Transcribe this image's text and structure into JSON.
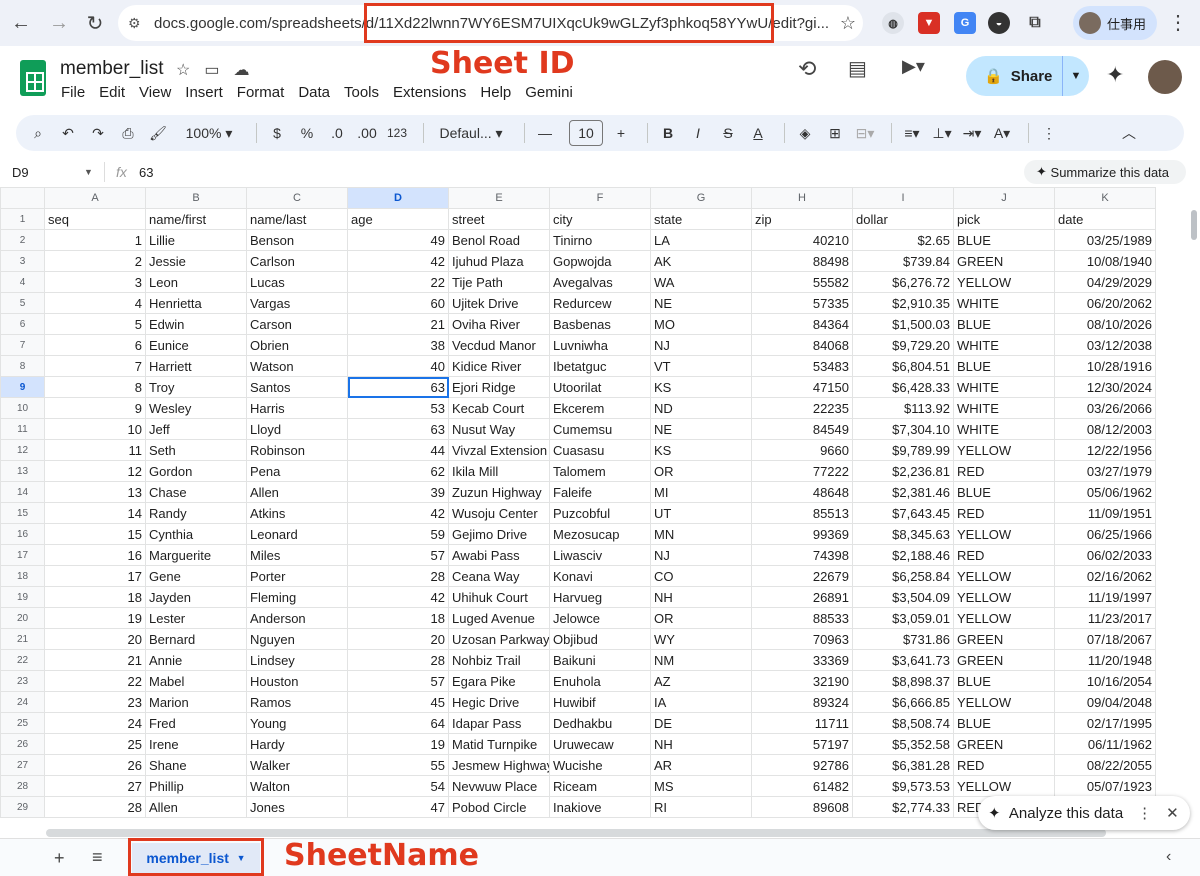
{
  "browser": {
    "url": "docs.google.com/spreadsheets/d/11Xd22lwnn7WY6ESM7UIXqcUk9wGLZyf3phkoq58YYwU/edit?gi...",
    "profile_label": "仕事用"
  },
  "annotations": {
    "sheet_id_label": "Sheet ID",
    "sheet_name_label": "SheetName"
  },
  "doc": {
    "title": "member_list",
    "menus": [
      "File",
      "Edit",
      "View",
      "Insert",
      "Format",
      "Data",
      "Tools",
      "Extensions",
      "Help",
      "Gemini"
    ],
    "share_label": "Share"
  },
  "toolbar": {
    "zoom": "100%",
    "currency": "$",
    "percent": "%",
    "dec_decrease": ".0",
    "dec_increase": ".00",
    "format_123": "123",
    "font": "Defaul...",
    "font_size": "10"
  },
  "formula_bar": {
    "cell_ref": "D9",
    "value": "63",
    "summarize_label": "Summarize this data"
  },
  "grid": {
    "column_letters": [
      "A",
      "B",
      "C",
      "D",
      "E",
      "F",
      "G",
      "H",
      "I",
      "J",
      "K"
    ],
    "headers": [
      "seq",
      "name/first",
      "name/last",
      "age",
      "street",
      "city",
      "state",
      "zip",
      "dollar",
      "pick",
      "date"
    ],
    "rows": [
      [
        "1",
        "Lillie",
        "Benson",
        "49",
        "Benol Road",
        "Tinirno",
        "LA",
        "40210",
        "$2.65",
        "BLUE",
        "03/25/1989"
      ],
      [
        "2",
        "Jessie",
        "Carlson",
        "42",
        "Ijuhud Plaza",
        "Gopwojda",
        "AK",
        "88498",
        "$739.84",
        "GREEN",
        "10/08/1940"
      ],
      [
        "3",
        "Leon",
        "Lucas",
        "22",
        "Tije Path",
        "Avegalvas",
        "WA",
        "55582",
        "$6,276.72",
        "YELLOW",
        "04/29/2029"
      ],
      [
        "4",
        "Henrietta",
        "Vargas",
        "60",
        "Ujitek Drive",
        "Redurcew",
        "NE",
        "57335",
        "$2,910.35",
        "WHITE",
        "06/20/2062"
      ],
      [
        "5",
        "Edwin",
        "Carson",
        "21",
        "Oviha River",
        "Basbenas",
        "MO",
        "84364",
        "$1,500.03",
        "BLUE",
        "08/10/2026"
      ],
      [
        "6",
        "Eunice",
        "Obrien",
        "38",
        "Vecdud Manor",
        "Luvniwha",
        "NJ",
        "84068",
        "$9,729.20",
        "WHITE",
        "03/12/2038"
      ],
      [
        "7",
        "Harriett",
        "Watson",
        "40",
        "Kidice River",
        "Ibetatguc",
        "VT",
        "53483",
        "$6,804.51",
        "BLUE",
        "10/28/1916"
      ],
      [
        "8",
        "Troy",
        "Santos",
        "63",
        "Ejori Ridge",
        "Utoorilat",
        "KS",
        "47150",
        "$6,428.33",
        "WHITE",
        "12/30/2024"
      ],
      [
        "9",
        "Wesley",
        "Harris",
        "53",
        "Kecab Court",
        "Ekcerem",
        "ND",
        "22235",
        "$113.92",
        "WHITE",
        "03/26/2066"
      ],
      [
        "10",
        "Jeff",
        "Lloyd",
        "63",
        "Nusut Way",
        "Cumemsu",
        "NE",
        "84549",
        "$7,304.10",
        "WHITE",
        "08/12/2003"
      ],
      [
        "11",
        "Seth",
        "Robinson",
        "44",
        "Vivzal Extension",
        "Cuasasu",
        "KS",
        "9660",
        "$9,789.99",
        "YELLOW",
        "12/22/1956"
      ],
      [
        "12",
        "Gordon",
        "Pena",
        "62",
        "Ikila Mill",
        "Talomem",
        "OR",
        "77222",
        "$2,236.81",
        "RED",
        "03/27/1979"
      ],
      [
        "13",
        "Chase",
        "Allen",
        "39",
        "Zuzun Highway",
        "Faleife",
        "MI",
        "48648",
        "$2,381.46",
        "BLUE",
        "05/06/1962"
      ],
      [
        "14",
        "Randy",
        "Atkins",
        "42",
        "Wusoju Center",
        "Puzcobful",
        "UT",
        "85513",
        "$7,643.45",
        "RED",
        "11/09/1951"
      ],
      [
        "15",
        "Cynthia",
        "Leonard",
        "59",
        "Gejimo Drive",
        "Mezosucap",
        "MN",
        "99369",
        "$8,345.63",
        "YELLOW",
        "06/25/1966"
      ],
      [
        "16",
        "Marguerite",
        "Miles",
        "57",
        "Awabi Pass",
        "Liwasciv",
        "NJ",
        "74398",
        "$2,188.46",
        "RED",
        "06/02/2033"
      ],
      [
        "17",
        "Gene",
        "Porter",
        "28",
        "Ceana Way",
        "Konavi",
        "CO",
        "22679",
        "$6,258.84",
        "YELLOW",
        "02/16/2062"
      ],
      [
        "18",
        "Jayden",
        "Fleming",
        "42",
        "Uhihuk Court",
        "Harvueg",
        "NH",
        "26891",
        "$3,504.09",
        "YELLOW",
        "11/19/1997"
      ],
      [
        "19",
        "Lester",
        "Anderson",
        "18",
        "Luged Avenue",
        "Jelowce",
        "OR",
        "88533",
        "$3,059.01",
        "YELLOW",
        "11/23/2017"
      ],
      [
        "20",
        "Bernard",
        "Nguyen",
        "20",
        "Uzosan Parkway",
        "Objibud",
        "WY",
        "70963",
        "$731.86",
        "GREEN",
        "07/18/2067"
      ],
      [
        "21",
        "Annie",
        "Lindsey",
        "28",
        "Nohbiz Trail",
        "Baikuni",
        "NM",
        "33369",
        "$3,641.73",
        "GREEN",
        "11/20/1948"
      ],
      [
        "22",
        "Mabel",
        "Houston",
        "57",
        "Egara Pike",
        "Enuhola",
        "AZ",
        "32190",
        "$8,898.37",
        "BLUE",
        "10/16/2054"
      ],
      [
        "23",
        "Marion",
        "Ramos",
        "45",
        "Hegic Drive",
        "Huwibif",
        "IA",
        "89324",
        "$6,666.85",
        "YELLOW",
        "09/04/2048"
      ],
      [
        "24",
        "Fred",
        "Young",
        "64",
        "Idapar Pass",
        "Dedhakbu",
        "DE",
        "11711",
        "$8,508.74",
        "BLUE",
        "02/17/1995"
      ],
      [
        "25",
        "Irene",
        "Hardy",
        "19",
        "Matid Turnpike",
        "Uruwecaw",
        "NH",
        "57197",
        "$5,352.58",
        "GREEN",
        "06/11/1962"
      ],
      [
        "26",
        "Shane",
        "Walker",
        "55",
        "Jesmew Highway",
        "Wucishe",
        "AR",
        "92786",
        "$6,381.28",
        "RED",
        "08/22/2055"
      ],
      [
        "27",
        "Phillip",
        "Walton",
        "54",
        "Nevwuw Place",
        "Riceam",
        "MS",
        "61482",
        "$9,573.53",
        "YELLOW",
        "05/07/1923"
      ],
      [
        "28",
        "Allen",
        "Jones",
        "47",
        "Pobod Circle",
        "Inakiove",
        "RI",
        "89608",
        "$2,774.33",
        "RED",
        ""
      ]
    ]
  },
  "analyze_label": "Analyze this data",
  "sheet_tab": "member_list"
}
